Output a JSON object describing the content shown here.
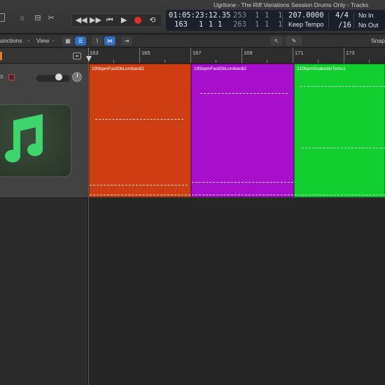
{
  "window": {
    "title": "Ugritone - The Riff Variations Session Drums Only - Tracks"
  },
  "transport": {
    "buttons": [
      "rewind",
      "fast-forward",
      "to-start",
      "play",
      "record",
      "cycle"
    ],
    "glyphs": {
      "rewind": "◀◀",
      "forward": "▶▶",
      "start": "⏮",
      "play": "▶",
      "cycle": "⟲"
    }
  },
  "lcd": {
    "time": "01:05:23:12.35",
    "bars_top": [
      "253",
      "1",
      "1",
      "1"
    ],
    "bars_bottom": [
      "263",
      "1",
      "1",
      "1"
    ],
    "position": [
      "163",
      "1",
      "1",
      "1"
    ],
    "tempo": "207.0000",
    "tempo_mode": "Keep Tempo",
    "signature": "4/4",
    "division": "/16",
    "midi_in": "No In",
    "midi_out": "No Out",
    "colors": {
      "background": "#1a1f2a",
      "text": "#e8e8e8"
    }
  },
  "toolbar": {
    "functions_label": "unctions",
    "view_label": "View",
    "snap_label": "Snap:"
  },
  "ruler": {
    "bars": [
      "163",
      "165",
      "167",
      "169",
      "171",
      "173"
    ]
  },
  "regions": [
    {
      "name": "195bpmFastDbLombardi1",
      "color": "#cf3e12"
    },
    {
      "name": "195bpmFastDbLombardi2",
      "color": "#a80fcc"
    },
    {
      "name": "210bpmSoakedinToms1",
      "color": "#11cf2e"
    }
  ],
  "track": {
    "label": "S",
    "icon": "music-note-icon",
    "icon_color": "#3ed66c"
  }
}
